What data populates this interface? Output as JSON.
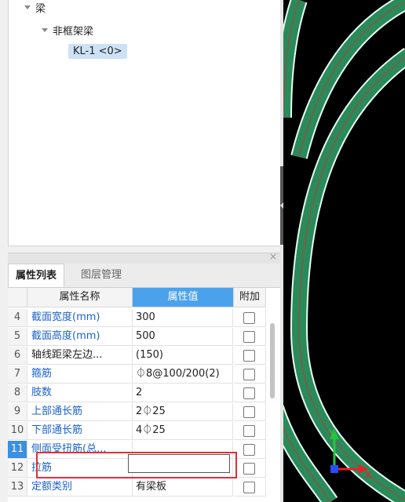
{
  "tree": {
    "root_label": "梁",
    "child_label": "非框架梁",
    "selected_label": "KL-1 <0>"
  },
  "panel": {
    "close_glyph": "×",
    "tabs": [
      {
        "label": "属性列表"
      },
      {
        "label": "图层管理"
      }
    ]
  },
  "grid": {
    "headers": [
      "属性名称",
      "属性值",
      "附加"
    ],
    "rows": [
      {
        "num": "4",
        "name": "截面宽度(mm)",
        "value": "300"
      },
      {
        "num": "5",
        "name": "截面高度(mm)",
        "value": "500"
      },
      {
        "num": "6",
        "name": "轴线距梁左边...",
        "value": "(150)"
      },
      {
        "num": "7",
        "name": "箍筋",
        "value": "⏀8@100/200(2)"
      },
      {
        "num": "8",
        "name": "肢数",
        "value": "2"
      },
      {
        "num": "9",
        "name": "上部通长筋",
        "value": "2⏀25"
      },
      {
        "num": "10",
        "name": "下部通长筋",
        "value": "4⏀25"
      },
      {
        "num": "11",
        "name": "侧面受扭筋(总...",
        "value": ""
      },
      {
        "num": "12",
        "name": "拉筋",
        "value": ""
      },
      {
        "num": "13",
        "name": "定额类别",
        "value": "有梁板"
      }
    ]
  },
  "canvas": {
    "axis_x_label": "X",
    "axis_y_label": "Y",
    "colors": {
      "background": "#000000",
      "beam": "#2a8a5a",
      "beam_edge": "#e8fff4",
      "axis_x": "#e8202a",
      "axis_y": "#22c83a",
      "origin": "#2a4dff"
    }
  }
}
